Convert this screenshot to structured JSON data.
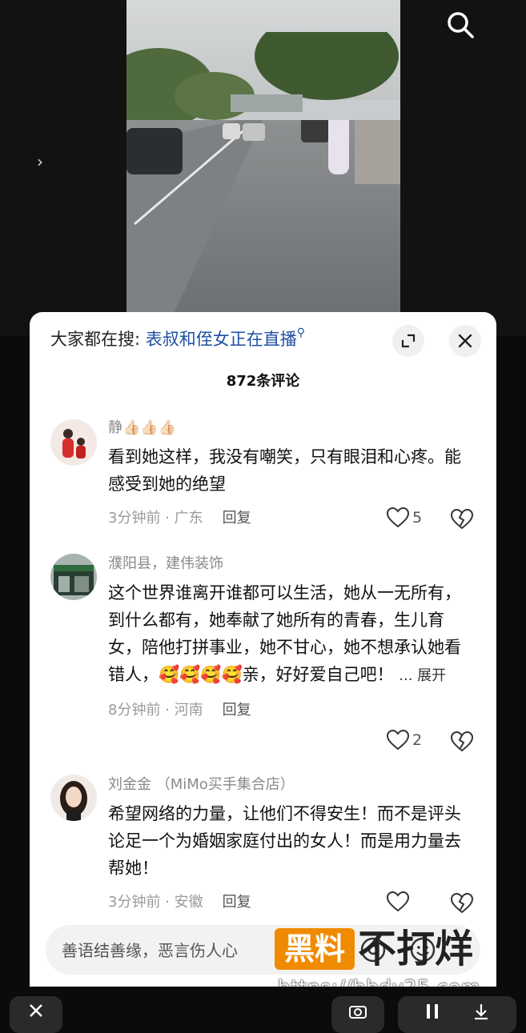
{
  "search": {
    "prefix": "大家都在搜:",
    "keyword": "表叔和侄女正在直播"
  },
  "comments_count_title": "872条评论",
  "comments": [
    {
      "name": "静👍🏻👍🏻👍🏻",
      "text": "看到她这样，我没有嘲笑，只有眼泪和心疼。能感受到她的绝望",
      "time": "3分钟前 · 广东",
      "reply": "回复",
      "likes": "5",
      "more": ""
    },
    {
      "name": "濮阳县，建伟装饰",
      "text": "这个世界谁离开谁都可以生活，她从一无所有，到什么都有，她奉献了她所有的青春，生儿育女，陪他打拼事业，她不甘心，她不想承认她看错人，🥰🥰🥰🥰亲，好好爱自己吧！",
      "time": "8分钟前 · 河南",
      "reply": "回复",
      "likes": "2",
      "more": "... 展开"
    },
    {
      "name": "刘金金 （MiMo买手集合店）",
      "text": "希望网络的力量，让他们不得安生！而不是评头论足一个为婚姻家庭付出的女人！而是用力量去帮她！",
      "time": "3分钟前 · 安徽",
      "reply": "回复",
      "likes": "",
      "more": ""
    }
  ],
  "input": {
    "placeholder": "善语结善缘，恶言伤人心"
  },
  "watermark": {
    "box": "黑料",
    "big": "不打烊",
    "url": "https://bbdy25.com"
  },
  "icons": [
    "search-icon",
    "expand-icon",
    "close-icon",
    "heart-icon",
    "broken-heart-icon",
    "at-icon",
    "emoji-icon",
    "pause-icon",
    "download-icon"
  ]
}
